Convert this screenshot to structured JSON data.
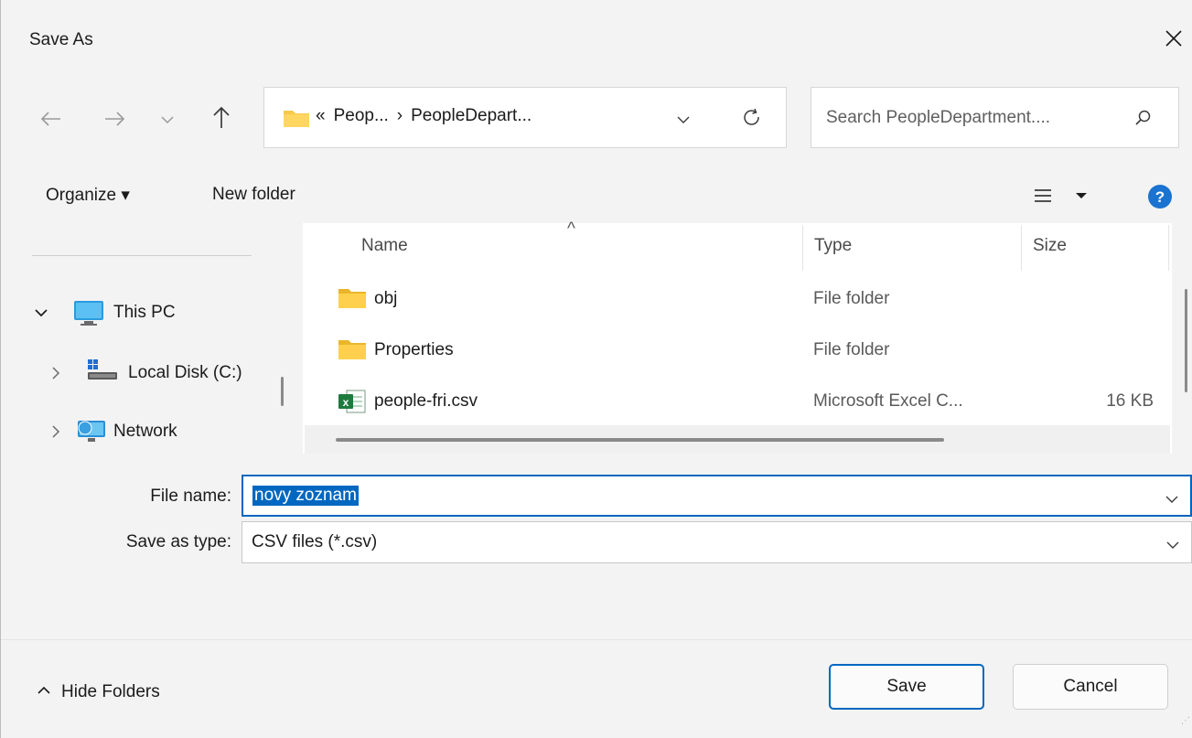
{
  "window": {
    "title": "Save As"
  },
  "address_bar": {
    "crumbs": [
      "«",
      "Peop...",
      "›",
      "PeopleDepart..."
    ]
  },
  "search": {
    "placeholder": "Search PeopleDepartment...."
  },
  "toolbar": {
    "organize_label": "Organize ▾",
    "new_folder_label": "New folder"
  },
  "nav_pane": {
    "items": [
      {
        "label": "This PC",
        "icon": "monitor-icon",
        "expander": "expanded"
      },
      {
        "label": "Local Disk (C:)",
        "icon": "drive-icon",
        "expander": "collapsed"
      },
      {
        "label": "Network",
        "icon": "network-icon",
        "expander": "collapsed"
      }
    ]
  },
  "file_list": {
    "columns": [
      "Name",
      "Type",
      "Size"
    ],
    "sort_indicator": "^",
    "rows": [
      {
        "name": "obj",
        "type": "File folder",
        "size": "",
        "icon": "folder-icon"
      },
      {
        "name": "Properties",
        "type": "File folder",
        "size": "",
        "icon": "folder-icon"
      },
      {
        "name": "people-fri.csv",
        "type": "Microsoft Excel C...",
        "size": "16 KB",
        "icon": "excel-csv-icon"
      }
    ]
  },
  "form": {
    "file_name_label": "File name:",
    "file_name_value": "novy zoznam",
    "save_type_label": "Save as type:",
    "save_type_value": "CSV files (*.csv)"
  },
  "footer": {
    "hide_folders_label": "Hide Folders",
    "save_label": "Save",
    "cancel_label": "Cancel"
  },
  "colors": {
    "accent": "#0067c0",
    "background": "#f3f3f3",
    "folder": "#f7c948",
    "excel_green": "#1f7a3e"
  }
}
